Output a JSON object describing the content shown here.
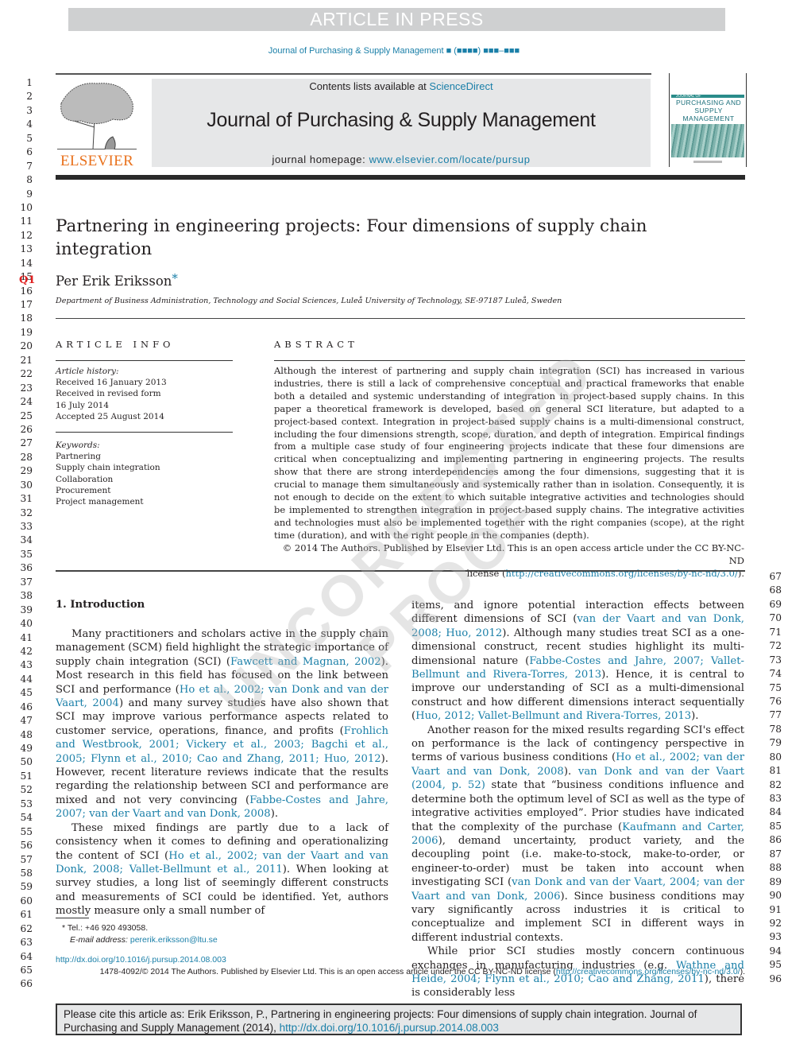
{
  "banner": "ARTICLE IN PRESS",
  "running_head": "Journal of Purchasing & Supply Management ■ (■■■■) ■■■–■■■",
  "masthead": {
    "contents_prefix": "Contents lists available at ",
    "contents_link": "ScienceDirect",
    "journal_title": "Journal of Purchasing & Supply Management",
    "homepage_prefix": "journal homepage: ",
    "homepage_link": "www.elsevier.com/locate/pursup",
    "publisher_logo": "ELSEVIER",
    "cover_title": "PURCHASING AND SUPPLY MANAGEMENT",
    "cover_small": "JOURNAL OF"
  },
  "line_numbers_left": [
    "1",
    "2",
    "3",
    "4",
    "5",
    "6",
    "7",
    "8",
    "9",
    "10",
    "11",
    "12",
    "13",
    "14",
    "15",
    "16",
    "17",
    "18",
    "19",
    "20",
    "21",
    "22",
    "23",
    "24",
    "25",
    "26",
    "27",
    "28",
    "29",
    "30",
    "31",
    "32",
    "33",
    "34",
    "35",
    "36",
    "37",
    "38",
    "39",
    "40",
    "41",
    "42",
    "43",
    "44",
    "45",
    "46",
    "47",
    "48",
    "49",
    "50",
    "51",
    "52",
    "53",
    "54",
    "55",
    "56",
    "57",
    "58",
    "59",
    "60",
    "61",
    "62",
    "63",
    "64",
    "65",
    "66"
  ],
  "line_numbers_right": [
    "67",
    "68",
    "69",
    "70",
    "71",
    "72",
    "73",
    "74",
    "75",
    "76",
    "77",
    "78",
    "79",
    "80",
    "81",
    "82",
    "83",
    "84",
    "85",
    "86",
    "87",
    "88",
    "89",
    "90",
    "91",
    "92",
    "93",
    "94",
    "95",
    "96"
  ],
  "query_marker": "Q1",
  "article": {
    "title": "Partnering in engineering projects: Four dimensions of supply chain integration",
    "author": "Per Erik Eriksson",
    "author_mark": "*",
    "affiliation": "Department of Business Administration, Technology and Social Sciences, Luleå University of Technology, SE-97187 Luleå, Sweden"
  },
  "article_info": {
    "heading": "ARTICLE INFO",
    "history_label": "Article history:",
    "history": [
      "Received 16 January 2013",
      "Received in revised form",
      "16 July 2014",
      "Accepted 25 August 2014"
    ],
    "keywords_label": "Keywords:",
    "keywords": [
      "Partnering",
      "Supply chain integration",
      "Collaboration",
      "Procurement",
      "Project management"
    ]
  },
  "abstract": {
    "heading": "ABSTRACT",
    "text": "Although the interest of partnering and supply chain integration (SCI) has increased in various industries, there is still a lack of comprehensive conceptual and practical frameworks that enable both a detailed and systemic understanding of integration in project-based supply chains. In this paper a theoretical framework is developed, based on general SCI literature, but adapted to a project-based context. Integration in project-based supply chains is a multi-dimensional construct, including the four dimensions strength, scope, duration, and depth of integration. Empirical findings from a multiple case study of four engineering projects indicate that these four dimensions are critical when conceptualizing and implementing partnering in engineering projects. The results show that there are strong interdependencies among the four dimensions, suggesting that it is crucial to manage them simultaneously and systemically rather than in isolation. Consequently, it is not enough to decide on the extent to which suitable integrative activities and technologies should be implemented to strengthen integration in project-based supply chains. The integrative activities and technologies must also be implemented together with the right companies (scope), at the right time (duration), and with the right people in the companies (depth).",
    "copyright_line": "© 2014 The Authors. Published by Elsevier Ltd. This is an open access article under the CC BY-NC-ND",
    "license_prefix": "license (",
    "license_link": "http://creativecommons.org/licenses/by-nc-nd/3.0/",
    "license_suffix": ")."
  },
  "intro": {
    "heading": "1.  Introduction",
    "left": [
      [
        {
          "t": "Many practitioners and scholars active in the supply chain management (SCM) field highlight the strategic importance of supply chain integration (SCI) ("
        },
        {
          "l": "Fawcett and Magnan, 2002"
        },
        {
          "t": "). Most research in this field has focused on the link between SCI and performance ("
        },
        {
          "l": "Ho et al., 2002; van Donk and van der Vaart, 2004"
        },
        {
          "t": ") and many survey studies have also shown that SCI may improve various performance aspects related to customer service, operations, finance, and profits ("
        },
        {
          "l": "Frohlich and Westbrook, 2001; Vickery et al., 2003; Bagchi et al., 2005; Flynn et al., 2010; Cao and Zhang, 2011; Huo, 2012"
        },
        {
          "t": "). However, recent literature reviews indicate that the results regarding the relationship between SCI and performance are mixed and not very convincing ("
        },
        {
          "l": "Fabbe-Costes and Jahre, 2007; van der Vaart and van Donk, 2008"
        },
        {
          "t": ")."
        }
      ],
      [
        {
          "t": "These mixed findings are partly due to a lack of consistency when it comes to defining and operationalizing the content of SCI ("
        },
        {
          "l": "Ho et al., 2002; van der Vaart and van Donk, 2008; Vallet-Bellmunt et al., 2011"
        },
        {
          "t": "). When looking at survey studies, a long list of seemingly different constructs and measurements of SCI could be identified. Yet, authors mostly measure only a small number of"
        }
      ]
    ],
    "right": [
      [
        {
          "t": "items, and ignore potential interaction effects between different dimensions of SCI ("
        },
        {
          "l": "van der Vaart and van Donk, 2008; Huo, 2012"
        },
        {
          "t": "). Although many studies treat SCI as a one-dimensional construct, recent studies highlight its multi-dimensional nature ("
        },
        {
          "l": "Fabbe-Costes and Jahre, 2007; Vallet-Bellmunt and Rivera-Torres, 2013"
        },
        {
          "t": "). Hence, it is central to improve our understanding of SCI as a multi-dimensional construct and how different dimensions interact sequentially ("
        },
        {
          "l": "Huo, 2012; Vallet-Bellmunt and Rivera-Torres, 2013"
        },
        {
          "t": ")."
        }
      ],
      [
        {
          "t": "Another reason for the mixed results regarding SCI's effect on performance is the lack of contingency perspective in terms of various business conditions ("
        },
        {
          "l": "Ho et al., 2002; van der Vaart and van Donk, 2008"
        },
        {
          "t": "). "
        },
        {
          "l": "van Donk and van der Vaart (2004, p. 52)"
        },
        {
          "t": " state that “business conditions influence and determine both the optimum level of SCI as well as the type of integrative activities employed”. Prior studies have indicated that the complexity of the purchase ("
        },
        {
          "l": "Kaufmann and Carter, 2006"
        },
        {
          "t": "), demand uncertainty, product variety, and the decoupling point (i.e. make-to-stock, make-to-order, or engineer-to-order) must be taken into account when investigating SCI ("
        },
        {
          "l": "van Donk and van der Vaart, 2004; van der Vaart and van Donk, 2006"
        },
        {
          "t": "). Since business conditions may vary significantly across industries it is critical to conceptualize and implement SCI in different ways in different industrial contexts."
        }
      ],
      [
        {
          "t": "While prior SCI studies mostly concern continuous exchanges in manufacturing industries (e.g. "
        },
        {
          "l": "Wathne and Heide, 2004; Flynn et al., 2010; Cao and Zhang, 2011"
        },
        {
          "t": "), there is considerably less"
        }
      ]
    ]
  },
  "footnote": {
    "tel": "* Tel.: +46 920 493058.",
    "email_label": "E-mail address: ",
    "email": "pererik.eriksson@ltu.se"
  },
  "doi_link": "http://dx.doi.org/10.1016/j.pursup.2014.08.003",
  "issn_line": "1478-4092/© 2014 The Authors. Published by Elsevier Ltd. This is an open access article under the CC BY-NC-ND license (",
  "issn_link": "http://creativecommons.org/licenses/by-nc-nd/3.0/",
  "issn_suffix": ").",
  "cite_box": {
    "text": "Please cite this article as: Erik Eriksson, P., Partnering in engineering projects: Four dimensions of supply chain integration. Journal of Purchasing and Supply Management (2014), ",
    "link": "http://dx.doi.org/10.1016/j.pursup.2014.08.003"
  },
  "watermark": "UNCORRECTED PROOF",
  "colors": {
    "link": "#1a7fa8",
    "elsevier_orange": "#e9711c",
    "masthead_gray": "#e6e7e8",
    "query_red": "#e02020"
  }
}
